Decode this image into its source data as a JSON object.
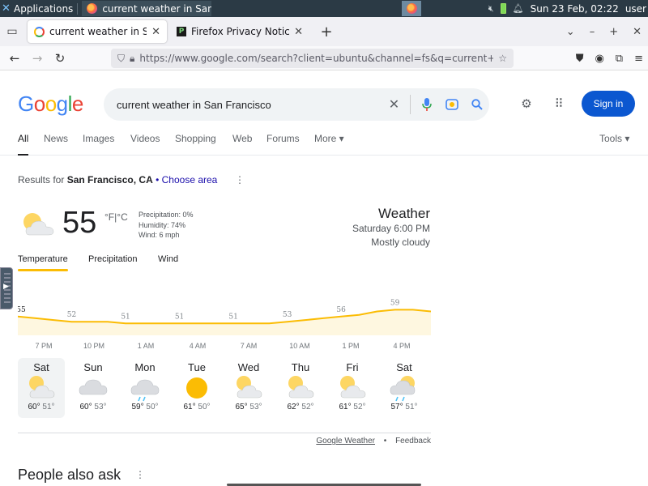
{
  "os_panel": {
    "apps_label": "Applications",
    "window_title": "current weather in San F…",
    "datetime": "Sun 23 Feb, 02:22",
    "user": "user"
  },
  "tabs": [
    {
      "title": "current weather in San Fr",
      "active": true
    },
    {
      "title": "Firefox Privacy Notice —",
      "active": false
    }
  ],
  "urlbar": {
    "url": "https://www.google.com/search?client=ubuntu&channel=fs&q=current+wea"
  },
  "google": {
    "logo_letters": [
      {
        "ch": "G",
        "color": "#4285f4"
      },
      {
        "ch": "o",
        "color": "#ea4335"
      },
      {
        "ch": "o",
        "color": "#fbbc05"
      },
      {
        "ch": "g",
        "color": "#4285f4"
      },
      {
        "ch": "l",
        "color": "#34a853"
      },
      {
        "ch": "e",
        "color": "#ea4335"
      }
    ],
    "query": "current weather in San Francisco",
    "signin_label": "Sign in",
    "tabs": [
      "All",
      "News",
      "Images",
      "Videos",
      "Shopping",
      "Web",
      "Forums",
      "More ▾"
    ],
    "tools_label": "Tools ▾"
  },
  "weather": {
    "results_prefix": "Results for",
    "location": "San Francisco, CA",
    "choose_area": "Choose area",
    "current_temp": "55",
    "unit_f": "°F",
    "unit_c": "°C",
    "precipitation": "Precipitation: 0%",
    "humidity": "Humidity: 74%",
    "wind": "Wind: 6 mph",
    "heading": "Weather",
    "time": "Saturday 6:00 PM",
    "condition": "Mostly cloudy",
    "tabs": [
      "Temperature",
      "Precipitation",
      "Wind"
    ],
    "hours": [
      "7 PM",
      "10 PM",
      "1 AM",
      "4 AM",
      "7 AM",
      "10 AM",
      "1 PM",
      "4 PM"
    ],
    "days": [
      {
        "name": "Sat",
        "hi": "60°",
        "lo": "51°",
        "icon": "partly-cloudy-icon"
      },
      {
        "name": "Sun",
        "hi": "60°",
        "lo": "53°",
        "icon": "cloudy-icon"
      },
      {
        "name": "Mon",
        "hi": "59°",
        "lo": "50°",
        "icon": "rain-icon"
      },
      {
        "name": "Tue",
        "hi": "61°",
        "lo": "50°",
        "icon": "sunny-icon"
      },
      {
        "name": "Wed",
        "hi": "65°",
        "lo": "53°",
        "icon": "partly-cloudy-icon"
      },
      {
        "name": "Thu",
        "hi": "62°",
        "lo": "52°",
        "icon": "partly-cloudy-icon"
      },
      {
        "name": "Fri",
        "hi": "61°",
        "lo": "52°",
        "icon": "partly-cloudy-icon"
      },
      {
        "name": "Sat",
        "hi": "57°",
        "lo": "51°",
        "icon": "partly-cloudy-rain-icon"
      }
    ],
    "footer_link": "Google Weather",
    "footer_bullet": "•",
    "feedback": "Feedback"
  },
  "people_also_ask": "People also ask",
  "colors": {
    "accent_blue": "#0b57d0",
    "chart_line": "#fbbc04",
    "chart_fill": "#fef7e0"
  },
  "chart_data": {
    "type": "area",
    "x": [
      "6 PM",
      "7 PM",
      "8 PM",
      "9 PM",
      "10 PM",
      "11 PM",
      "12 AM",
      "1 AM",
      "2 AM",
      "3 AM",
      "4 AM",
      "5 AM",
      "6 AM",
      "7 AM",
      "8 AM",
      "9 AM",
      "10 AM",
      "11 AM",
      "12 PM",
      "1 PM",
      "2 PM",
      "3 PM",
      "4 PM",
      "5 PM"
    ],
    "values": [
      55,
      54,
      53,
      52,
      52,
      52,
      51,
      51,
      51,
      51,
      51,
      51,
      51,
      51,
      51,
      52,
      53,
      54,
      55,
      56,
      58,
      59,
      59,
      58
    ],
    "labels": [
      {
        "index": 0,
        "text": "55"
      },
      {
        "index": 3,
        "text": "52"
      },
      {
        "index": 6,
        "text": "51"
      },
      {
        "index": 9,
        "text": "51"
      },
      {
        "index": 12,
        "text": "51"
      },
      {
        "index": 15,
        "text": "53"
      },
      {
        "index": 18,
        "text": "56"
      },
      {
        "index": 21,
        "text": "59"
      }
    ],
    "ylim": [
      45,
      62
    ]
  }
}
